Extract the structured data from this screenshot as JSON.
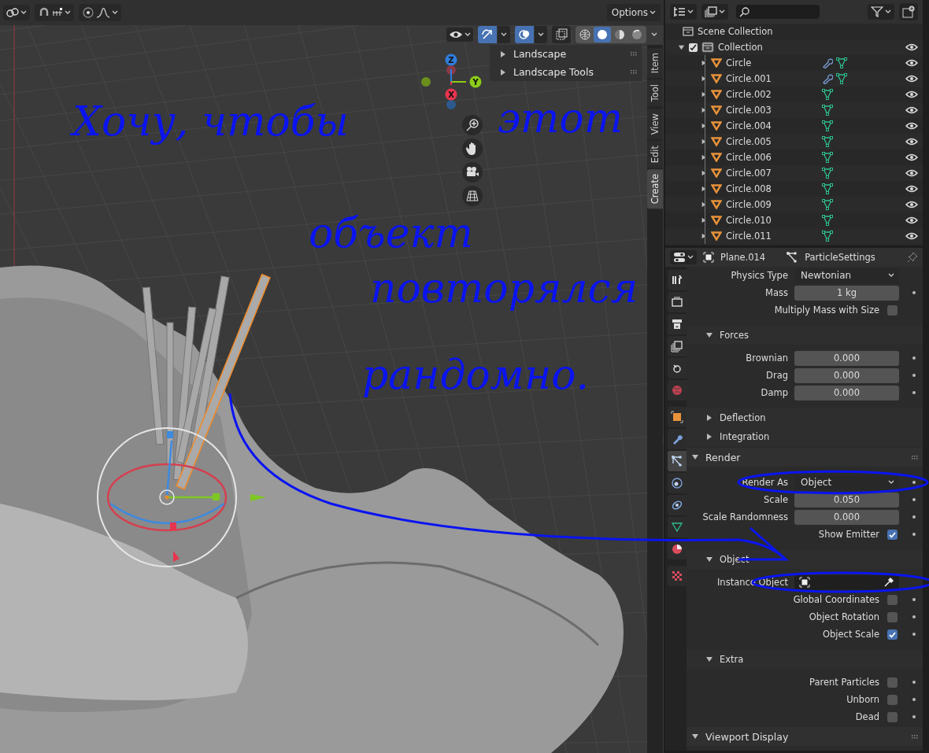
{
  "viewport": {
    "options": "Options",
    "overlay_toggles": {
      "gizmos_on": true,
      "overlays_on": true,
      "xray_on": false
    },
    "shading_modes": [
      {
        "kind": "wireframe",
        "selected": false
      },
      {
        "kind": "solid",
        "selected": true
      },
      {
        "kind": "material",
        "selected": false
      },
      {
        "kind": "rendered",
        "selected": false
      }
    ],
    "axes": [
      {
        "label": "Z",
        "color": "#2f7ddc"
      },
      {
        "label": "Y",
        "color": "#8ccc18"
      },
      {
        "label": "X",
        "color": "#e8344e"
      }
    ],
    "npanel": {
      "panels": [
        {
          "label": "Landscape",
          "expanded": false
        },
        {
          "label": "Landscape Tools",
          "expanded": false
        }
      ],
      "tabs": [
        {
          "label": "Item",
          "selected": false
        },
        {
          "label": "Tool",
          "selected": false
        },
        {
          "label": "View",
          "selected": false
        },
        {
          "label": "Edit",
          "selected": false
        },
        {
          "label": "Create",
          "selected": true
        }
      ]
    }
  },
  "annotation": {
    "lines": [
      "Хочу, чтобы",
      "этот",
      "объект",
      "повторялся",
      "рандомно."
    ]
  },
  "outliner": {
    "scene_collection": "Scene Collection",
    "collection": {
      "label": "Collection",
      "checked": true,
      "expanded": true,
      "children": [
        {
          "name": "Circle",
          "has_modifier": true
        },
        {
          "name": "Circle.001",
          "has_modifier": true
        },
        {
          "name": "Circle.002",
          "has_modifier": false
        },
        {
          "name": "Circle.003",
          "has_modifier": false
        },
        {
          "name": "Circle.004",
          "has_modifier": false
        },
        {
          "name": "Circle.005",
          "has_modifier": false
        },
        {
          "name": "Circle.006",
          "has_modifier": false
        },
        {
          "name": "Circle.007",
          "has_modifier": false
        },
        {
          "name": "Circle.008",
          "has_modifier": false
        },
        {
          "name": "Circle.009",
          "has_modifier": false
        },
        {
          "name": "Circle.010",
          "has_modifier": false
        },
        {
          "name": "Circle.011",
          "has_modifier": false
        }
      ]
    }
  },
  "properties": {
    "object": "Plane.014",
    "data": "ParticleSettings",
    "tabs": [
      {
        "kind": "tool",
        "selected": false
      },
      {
        "kind": "render",
        "selected": false
      },
      {
        "kind": "output",
        "selected": false
      },
      {
        "kind": "view_layer",
        "selected": false
      },
      {
        "kind": "scene",
        "selected": false
      },
      {
        "kind": "world",
        "selected": false
      },
      {
        "kind": "object",
        "selected": false
      },
      {
        "kind": "modifiers",
        "selected": false
      },
      {
        "kind": "particles",
        "selected": true
      },
      {
        "kind": "physics",
        "selected": false
      },
      {
        "kind": "constraints",
        "selected": false
      },
      {
        "kind": "data",
        "selected": false
      },
      {
        "kind": "material",
        "selected": false
      },
      {
        "kind": "texture",
        "selected": false
      }
    ],
    "rows": [
      {
        "kind": "dropdown",
        "label": "Physics Type",
        "value": "Newtonian",
        "keyframe": false
      },
      {
        "kind": "number",
        "label": "Mass",
        "value": "1 kg",
        "keyframe": true
      },
      {
        "kind": "checkbox",
        "label": "Multiply Mass with Size",
        "checked": false,
        "keyframe": false
      },
      {
        "kind": "subpanel",
        "label": "Forces",
        "expanded": true
      },
      {
        "kind": "number",
        "label": "Brownian",
        "value": "0.000",
        "keyframe": true
      },
      {
        "kind": "number",
        "label": "Drag",
        "value": "0.000",
        "keyframe": true
      },
      {
        "kind": "number",
        "label": "Damp",
        "value": "0.000",
        "keyframe": true
      },
      {
        "kind": "subpanel",
        "label": "Deflection",
        "expanded": false
      },
      {
        "kind": "subpanel",
        "label": "Integration",
        "expanded": false
      },
      {
        "kind": "panel",
        "label": "Render",
        "expanded": true
      },
      {
        "kind": "dropdown",
        "label": "Render As",
        "value": "Object",
        "keyframe": true
      },
      {
        "kind": "number",
        "label": "Scale",
        "value": "0.050",
        "keyframe": true
      },
      {
        "kind": "number",
        "label": "Scale Randomness",
        "value": "0.000",
        "keyframe": true
      },
      {
        "kind": "checkbox",
        "label": "Show Emitter",
        "checked": true,
        "keyframe": true
      },
      {
        "kind": "subpanel",
        "label": "Object",
        "expanded": true
      },
      {
        "kind": "object_field",
        "label": "Instance Object"
      },
      {
        "kind": "checkbox",
        "label": "Global Coordinates",
        "checked": false,
        "keyframe": true
      },
      {
        "kind": "checkbox",
        "label": "Object Rotation",
        "checked": false,
        "keyframe": true
      },
      {
        "kind": "checkbox",
        "label": "Object Scale",
        "checked": true,
        "keyframe": true
      },
      {
        "kind": "subpanel",
        "label": "Extra",
        "expanded": true
      },
      {
        "kind": "checkbox",
        "label": "Parent Particles",
        "checked": false,
        "keyframe": true
      },
      {
        "kind": "checkbox",
        "label": "Unborn",
        "checked": false,
        "keyframe": true
      },
      {
        "kind": "checkbox",
        "label": "Dead",
        "checked": false,
        "keyframe": true
      },
      {
        "kind": "panel",
        "label": "Viewport Display",
        "expanded": true
      }
    ]
  }
}
